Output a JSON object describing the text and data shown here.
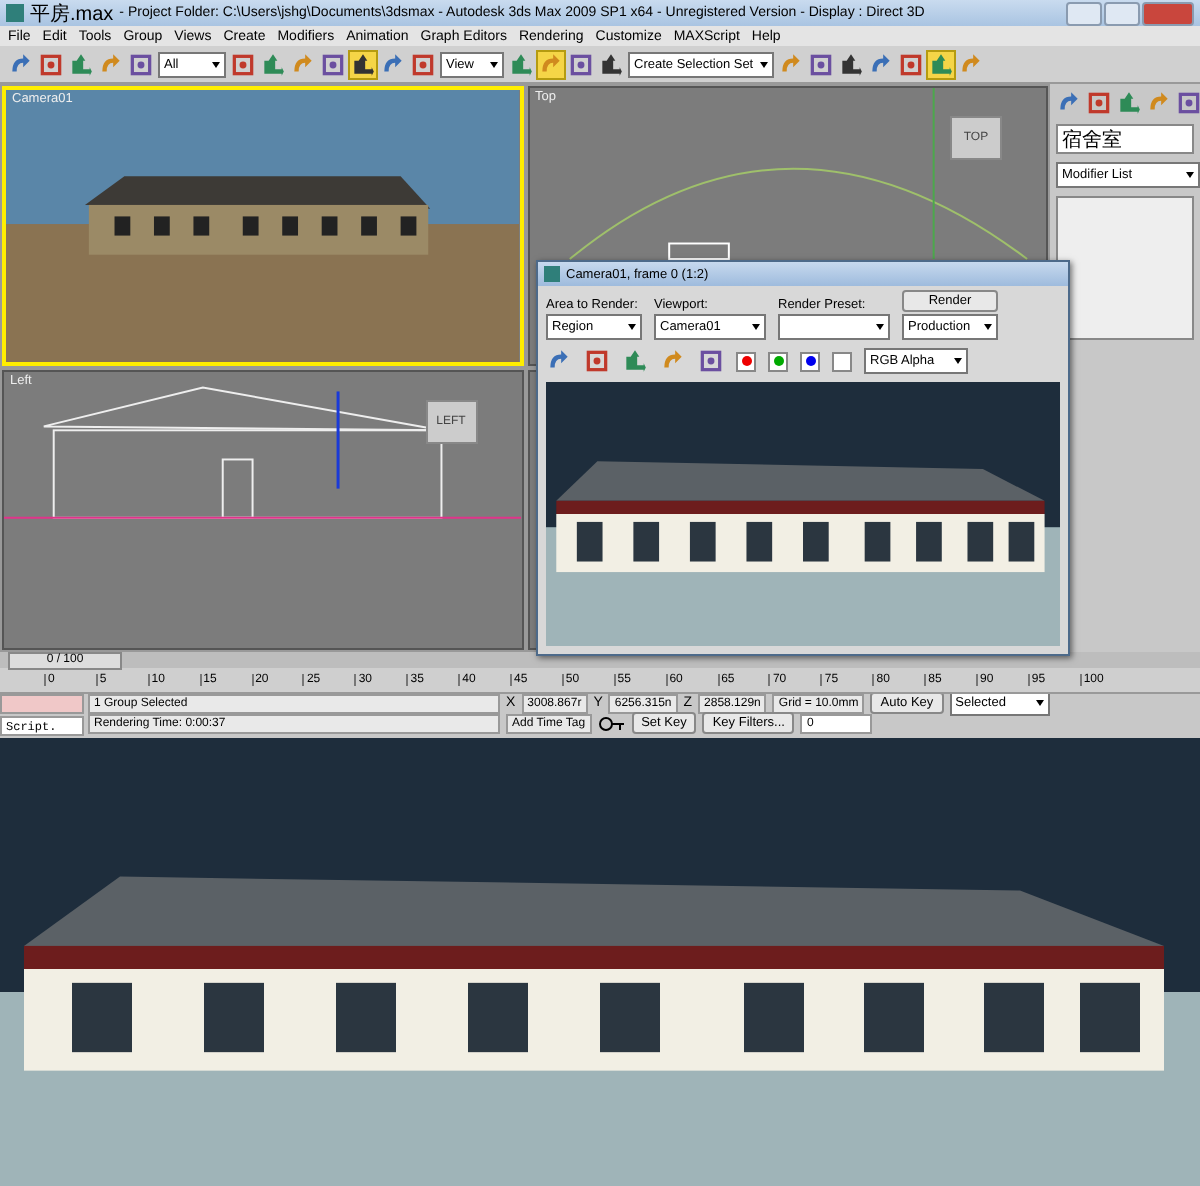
{
  "window": {
    "file": "平房.max",
    "title": "- Project Folder: C:\\Users\\jshg\\Documents\\3dsmax - Autodesk 3ds Max 2009 SP1  x64 - Unregistered Version - Display : Direct 3D"
  },
  "menu": [
    "File",
    "Edit",
    "Tools",
    "Group",
    "Views",
    "Create",
    "Modifiers",
    "Animation",
    "Graph Editors",
    "Rendering",
    "Customize",
    "MAXScript",
    "Help"
  ],
  "toolbar": {
    "selection_filter": "All",
    "reference_coord": "View",
    "selection_set": "Create Selection Set"
  },
  "viewports": [
    {
      "label": "Camera01",
      "active": true,
      "kind": "camera"
    },
    {
      "label": "Top",
      "active": false,
      "kind": "top",
      "cube_label": "TOP"
    },
    {
      "label": "Left",
      "active": false,
      "kind": "left",
      "cube_label": "LEFT"
    }
  ],
  "command_panel": {
    "object_name": "宿舍室",
    "modifier_list": "Modifier List"
  },
  "render_window": {
    "title": "Camera01, frame 0 (1:2)",
    "area_label": "Area to Render:",
    "area": "Region",
    "viewport_label": "Viewport:",
    "viewport": "Camera01",
    "preset_label": "Render Preset:",
    "render_button": "Render",
    "mode": "Production",
    "channel": "RGB Alpha"
  },
  "timeline": {
    "frame": "0 / 100",
    "level": 0,
    "ticks": [
      "0",
      "5",
      "10",
      "15",
      "20",
      "25",
      "30",
      "35",
      "40",
      "45",
      "50",
      "55",
      "60",
      "65",
      "70",
      "75",
      "80",
      "85",
      "90",
      "95",
      "100"
    ]
  },
  "status": {
    "script": "Script.",
    "selection": "1 Group Selected",
    "prompt": "Rendering Time: 0:00:37",
    "x_label": "X",
    "x": "3008.867r",
    "y_label": "Y",
    "y": "6256.315n",
    "z_label": "Z",
    "z": "2858.129n",
    "grid": "Grid = 10.0mm",
    "time_tag": "Add Time Tag",
    "auto_key": "Auto Key",
    "key_mode": "Selected",
    "set_key": "Set Key",
    "key_filters": "Key Filters...",
    "current_frame": "0"
  }
}
